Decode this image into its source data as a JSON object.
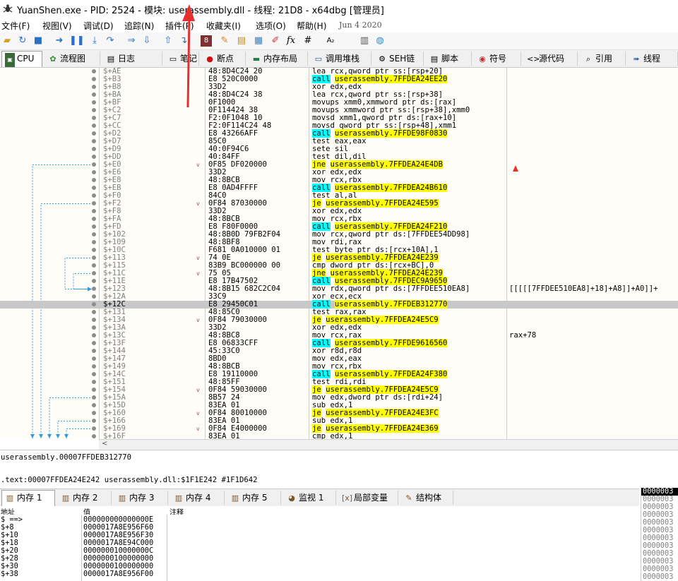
{
  "window": {
    "title": "YuanShen.exe - PID: 2524 - 模块: userassembly.dll - 线程: 21D8 - x64dbg [管理员]",
    "icon": "bug-icon"
  },
  "menu": {
    "items": [
      "文件(F)",
      "视图(V)",
      "调试(D)",
      "追踪(N)",
      "插件(P)",
      "收藏夹(I)",
      "选项(O)",
      "帮助(H)"
    ],
    "date": "Jun 4 2020"
  },
  "toolbar": {
    "icons": [
      "open-icon",
      "restart-icon",
      "stop-icon",
      "run-icon",
      "pause-icon",
      "step-into-icon",
      "step-over-icon",
      "trace-into-icon",
      "trace-over-icon",
      "execute-till-return-icon",
      "run-to-user-code-icon",
      "patch-icon",
      "comment-icon",
      "label-icon",
      "bookmark-icon",
      "function-icon",
      "expression-icon",
      "hash-icon",
      "font-icon",
      "calculator-icon",
      "update-icon"
    ],
    "fx_label": "fx",
    "hash_label": "#",
    "font_label": "A₂"
  },
  "tabs": [
    {
      "label": "CPU",
      "icon": "cpu-icon",
      "active": true
    },
    {
      "label": "流程图",
      "icon": "graph-icon"
    },
    {
      "label": "日志",
      "icon": "log-icon"
    },
    {
      "label": "笔记",
      "icon": "notes-icon"
    },
    {
      "label": "断点",
      "icon": "breakpoint-icon"
    },
    {
      "label": "内存布局",
      "icon": "memory-map-icon"
    },
    {
      "label": "调用堆栈",
      "icon": "call-stack-icon"
    },
    {
      "label": "SEH链",
      "icon": "seh-icon"
    },
    {
      "label": "脚本",
      "icon": "script-icon"
    },
    {
      "label": "符号",
      "icon": "symbols-icon"
    },
    {
      "label": "源代码",
      "icon": "source-icon"
    },
    {
      "label": "引用",
      "icon": "references-icon"
    },
    {
      "label": "线程",
      "icon": "threads-icon"
    }
  ],
  "disasm": {
    "rows": [
      {
        "addr": "$+AE",
        "bytes": "48:8D4C24 20",
        "instr": "lea rcx,qword ptr ss:[rsp+20]"
      },
      {
        "addr": "$+B3",
        "bytes": "E8 520C0000",
        "instr": "call userassembly.7FFDEA24EE20",
        "kind": "call"
      },
      {
        "addr": "$+B8",
        "bytes": "33D2",
        "instr": "xor edx,edx"
      },
      {
        "addr": "$+BA",
        "bytes": "48:8D4C24 38",
        "instr": "lea rcx,qword ptr ss:[rsp+38]"
      },
      {
        "addr": "$+BF",
        "bytes": "0F1000",
        "instr": "movups xmm0,xmmword ptr ds:[rax]"
      },
      {
        "addr": "$+C2",
        "bytes": "0F114424 38",
        "instr": "movups xmmword ptr ss:[rsp+38],xmm0"
      },
      {
        "addr": "$+C7",
        "bytes": "F2:0F1048 10",
        "instr": "movsd xmm1,qword ptr ds:[rax+10]"
      },
      {
        "addr": "$+CC",
        "bytes": "F2:0F114C24 48",
        "instr": "movsd qword ptr ss:[rsp+48],xmm1"
      },
      {
        "addr": "$+D2",
        "bytes": "E8 43266AFF",
        "instr": "call userassembly.7FFDE98F0830",
        "kind": "call"
      },
      {
        "addr": "$+D7",
        "bytes": "85C0",
        "instr": "test eax,eax"
      },
      {
        "addr": "$+D9",
        "bytes": "40:0F94C6",
        "instr": "sete sil"
      },
      {
        "addr": "$+DD",
        "bytes": "40:84FF",
        "instr": "test dil,dil"
      },
      {
        "addr": "$+E0",
        "bytes": "0F85 DF020000",
        "instr": "jne userassembly.7FFDEA24E4DB",
        "kind": "jmp",
        "chev": true
      },
      {
        "addr": "$+E6",
        "bytes": "33D2",
        "instr": "xor edx,edx"
      },
      {
        "addr": "$+E8",
        "bytes": "48:8BCB",
        "instr": "mov rcx,rbx"
      },
      {
        "addr": "$+EB",
        "bytes": "E8 0AD4FFFF",
        "instr": "call userassembly.7FFDEA24B610",
        "kind": "call"
      },
      {
        "addr": "$+F0",
        "bytes": "84C0",
        "instr": "test al,al"
      },
      {
        "addr": "$+F2",
        "bytes": "0F84 87030000",
        "instr": "je userassembly.7FFDEA24E595",
        "kind": "jmp",
        "chev": true
      },
      {
        "addr": "$+F8",
        "bytes": "33D2",
        "instr": "xor edx,edx"
      },
      {
        "addr": "$+FA",
        "bytes": "48:8BCB",
        "instr": "mov rcx,rbx"
      },
      {
        "addr": "$+FD",
        "bytes": "E8 F80F0000",
        "instr": "call userassembly.7FFDEA24F210",
        "kind": "call"
      },
      {
        "addr": "$+102",
        "bytes": "48:8B0D 79FB2F04",
        "instr": "mov rcx,qword ptr ds:[7FFDEE54DD98]"
      },
      {
        "addr": "$+109",
        "bytes": "48:8BF8",
        "instr": "mov rdi,rax"
      },
      {
        "addr": "$+10C",
        "bytes": "F681 0A010000 01",
        "instr": "test byte ptr ds:[rcx+10A],1"
      },
      {
        "addr": "$+113",
        "bytes": "74 0E",
        "instr": "je userassembly.7FFDEA24E239",
        "kind": "jmp",
        "chev": true
      },
      {
        "addr": "$+115",
        "bytes": "83B9 BC000000 00",
        "instr": "cmp dword ptr ds:[rcx+BC],0"
      },
      {
        "addr": "$+11C",
        "bytes": "75 05",
        "instr": "jne userassembly.7FFDEA24E239",
        "kind": "jmp",
        "chev": true
      },
      {
        "addr": "$+11E",
        "bytes": "E8 17B47502",
        "instr": "call userassembly.7FFDEC9A9650",
        "kind": "call"
      },
      {
        "addr": "$+123",
        "bytes": "48:8B15 682C2C04",
        "instr": "mov rdx,qword ptr ds:[7FFDEE510EA8]",
        "cmt": "[[[[[7FFDEE510EA8]+18]+A8]]+A0]]+"
      },
      {
        "addr": "$+12A",
        "bytes": "33C9",
        "instr": "xor ecx,ecx"
      },
      {
        "addr": "$+12C",
        "bytes": "E8 29450C01",
        "instr": "call userassembly.7FFDEB312770",
        "kind": "call",
        "sel": true
      },
      {
        "addr": "$+131",
        "bytes": "48:85C0",
        "instr": "test rax,rax"
      },
      {
        "addr": "$+134",
        "bytes": "0F84 79030000",
        "instr": "je userassembly.7FFDEA24E5C9",
        "kind": "jmp",
        "chev": true
      },
      {
        "addr": "$+13A",
        "bytes": "33D2",
        "instr": "xor edx,edx"
      },
      {
        "addr": "$+13C",
        "bytes": "48:8BC8",
        "instr": "mov rcx,rax",
        "cmt": "rax+78"
      },
      {
        "addr": "$+13F",
        "bytes": "E8 06833CFF",
        "instr": "call userassembly.7FFDE9616560",
        "kind": "call"
      },
      {
        "addr": "$+144",
        "bytes": "45:33C0",
        "instr": "xor r8d,r8d"
      },
      {
        "addr": "$+147",
        "bytes": "8BD0",
        "instr": "mov edx,eax"
      },
      {
        "addr": "$+149",
        "bytes": "48:8BCB",
        "instr": "mov rcx,rbx"
      },
      {
        "addr": "$+14C",
        "bytes": "E8 19110000",
        "instr": "call userassembly.7FFDEA24F380",
        "kind": "call"
      },
      {
        "addr": "$+151",
        "bytes": "48:85FF",
        "instr": "test rdi,rdi"
      },
      {
        "addr": "$+154",
        "bytes": "0F84 59030000",
        "instr": "je userassembly.7FFDEA24E5C9",
        "kind": "jmp",
        "chev": true
      },
      {
        "addr": "$+15A",
        "bytes": "8B57 24",
        "instr": "mov edx,dword ptr ds:[rdi+24]"
      },
      {
        "addr": "$+15D",
        "bytes": "83EA 01",
        "instr": "sub edx,1"
      },
      {
        "addr": "$+160",
        "bytes": "0F84 80010000",
        "instr": "je userassembly.7FFDEA24E3FC",
        "kind": "jmp",
        "chev": true
      },
      {
        "addr": "$+166",
        "bytes": "83EA 01",
        "instr": "sub edx,1"
      },
      {
        "addr": "$+169",
        "bytes": "0F84 E4000000",
        "instr": "je userassembly.7FFDEA24E369",
        "kind": "jmp",
        "chev": true
      },
      {
        "addr": "$+16F",
        "bytes": "83EA 01",
        "instr": "cmp edx,1"
      }
    ],
    "scroll_left": "<"
  },
  "info": {
    "line1": "userassembly.00007FFDEB312770",
    "line2": ".text:00007FFDEA24E242 userassembly.dll:$1F1E242 #1F1D642"
  },
  "mem_tabs": [
    {
      "label": "内存 1",
      "icon": "memory-icon",
      "active": true
    },
    {
      "label": "内存 2",
      "icon": "memory-icon"
    },
    {
      "label": "内存 3",
      "icon": "memory-icon"
    },
    {
      "label": "内存 4",
      "icon": "memory-icon"
    },
    {
      "label": "内存 5",
      "icon": "memory-icon"
    },
    {
      "label": "监视 1",
      "icon": "watch-icon"
    },
    {
      "label": "局部变量",
      "icon": "locals-icon"
    },
    {
      "label": "结构体",
      "icon": "struct-icon"
    }
  ],
  "mem_table": {
    "headers": [
      "地址",
      "值",
      "注释"
    ],
    "rows": [
      {
        "addr": "$ ==>",
        "val": "000000000000000E"
      },
      {
        "addr": "$+8",
        "val": "0000017A8E956F60"
      },
      {
        "addr": "$+10",
        "val": "0000017A8E956F30"
      },
      {
        "addr": "$+18",
        "val": "0000017A8E94C000"
      },
      {
        "addr": "$+20",
        "val": "000000010000000C"
      },
      {
        "addr": "$+28",
        "val": "0000000100000000"
      },
      {
        "addr": "$+30",
        "val": "0000000100000000"
      },
      {
        "addr": "$+38",
        "val": "0000017A8E956F00"
      }
    ]
  },
  "stack": {
    "rows": [
      "0000003",
      "0000003",
      "0000003",
      "0000003",
      "0000003",
      "0000003",
      "0000003",
      "0000003",
      "0000003",
      "0000003",
      "0000003",
      "0000003"
    ]
  },
  "colors": {
    "call_highlight": "#00ffff",
    "jump_highlight": "#ffff00",
    "selected_row": "#c8c8c8",
    "arrow": "#3399dd",
    "annotation_arrow": "#e53030"
  }
}
